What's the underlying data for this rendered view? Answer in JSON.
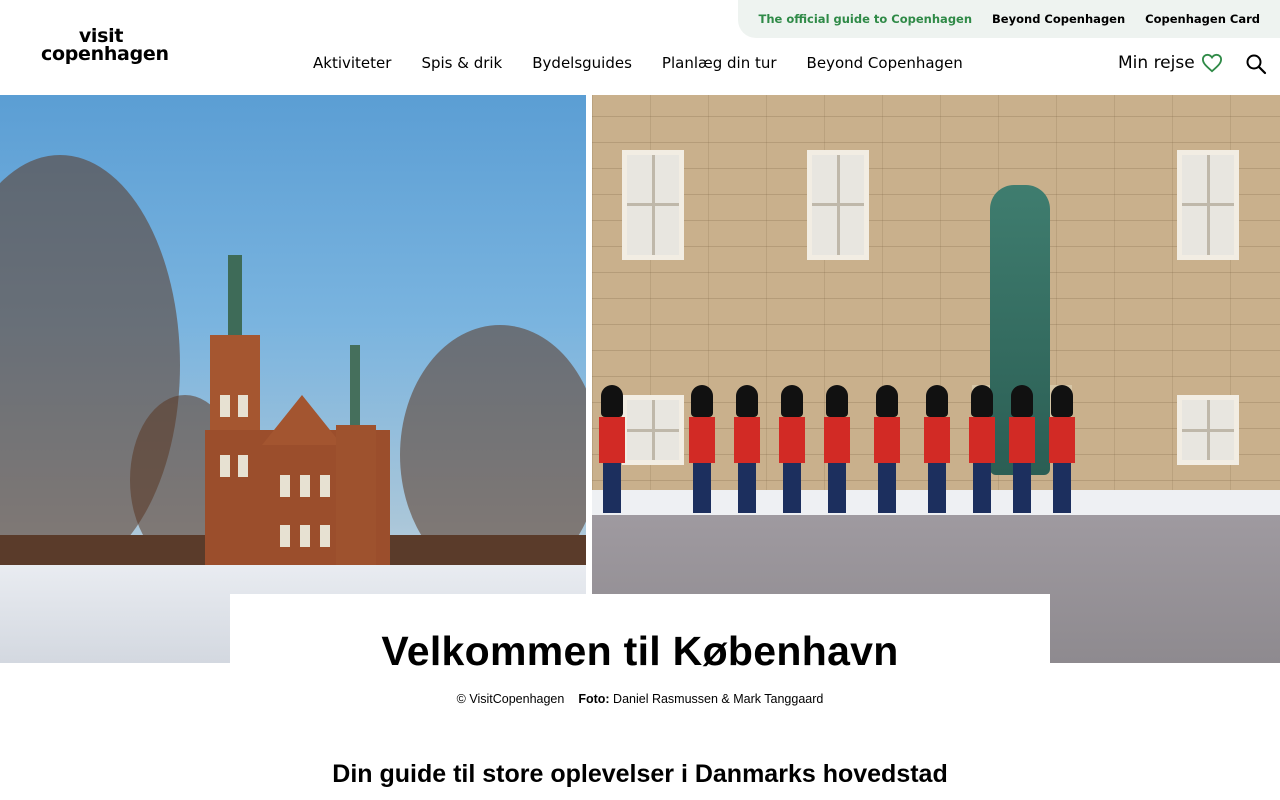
{
  "header": {
    "logo_line1": "visit",
    "logo_line2": "copenhagen",
    "topbar": {
      "official": "The official guide to Copenhagen",
      "beyond": "Beyond Copenhagen",
      "card": "Copenhagen Card"
    },
    "nav": [
      "Aktiviteter",
      "Spis & drik",
      "Bydelsguides",
      "Planlæg din tur",
      "Beyond Copenhagen"
    ],
    "my_journey": "Min rejse",
    "accent_color": "#2f8a47"
  },
  "hero": {
    "title": "Velkommen til København",
    "copyright": "© VisitCopenhagen",
    "photo_label": "Foto:",
    "photo_credit": "Daniel Rasmussen & Mark Tanggaard"
  },
  "intro": {
    "heading": "Din guide til store oplevelser i Danmarks hovedstad"
  },
  "icons": {
    "heart": "heart-icon",
    "search": "search-icon"
  }
}
